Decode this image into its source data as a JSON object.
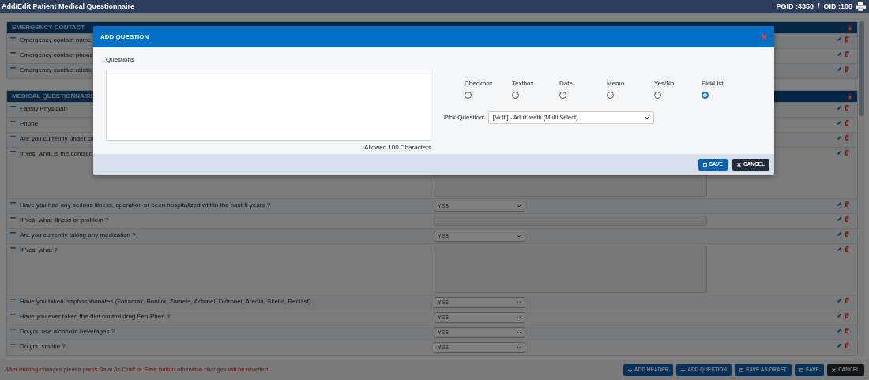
{
  "header": {
    "title": "Add/Edit Patient Medical Questionnaire",
    "ids": "PGID :4350  /  OID :100"
  },
  "sections": [
    {
      "title": "EMERGENCY CONTACT",
      "rows": [
        {
          "label": "Emergency contact name"
        },
        {
          "label": "Emergency contact phone"
        },
        {
          "label": "Emergency contact relatio"
        }
      ]
    },
    {
      "title": "MEDICAL QUESTIONNAIRE",
      "rows": [
        {
          "label": "Family Physician"
        },
        {
          "label": "Phone"
        },
        {
          "label": "Are you currently under ca"
        },
        {
          "label": "If Yes, what is the conditio",
          "kind": "memo"
        },
        {
          "label": "Have you had any serious illness, operation or been hospitalized within the past 5 years ?",
          "kind": "select",
          "value": "YES"
        },
        {
          "label": "If Yes, what illness or problem ?",
          "kind": "text"
        },
        {
          "label": "Are you currently taking any medication ?",
          "kind": "select",
          "value": "YES"
        },
        {
          "label": "If Yes, what ?",
          "kind": "memo"
        },
        {
          "label": "Have you taken bisphosphonates (Fosamax, Boniva, Zometa, Actonel, Didronel, Aredia, Skelid, Reclast)",
          "kind": "select",
          "value": "YES"
        },
        {
          "label": "Have you ever taken the diet control drug Fen-Phen ?",
          "kind": "select",
          "value": "YES"
        },
        {
          "label": "Do you use alcoholic beverages ?",
          "kind": "select",
          "value": "YES"
        },
        {
          "label": "Do you smoke ?",
          "kind": "select",
          "value": "YES"
        }
      ]
    }
  ],
  "footer": {
    "note": "After making changes please press Save As Draft or Save button otherwise changes will be reverted.",
    "buttons": [
      {
        "label": "ADD HEADER",
        "kind": "add"
      },
      {
        "label": "ADD QUESTION",
        "kind": "add"
      },
      {
        "label": "SAVE AS DRAFT",
        "kind": "save"
      },
      {
        "label": "SAVE",
        "kind": "save"
      },
      {
        "label": "CANCEL",
        "kind": "cancel"
      }
    ]
  },
  "modal": {
    "title": "ADD QUESTION",
    "questions_label": "Questions",
    "allowed": "Allowed 100 Characters",
    "types": [
      {
        "label": "Checkbox",
        "selected": false
      },
      {
        "label": "Textbox",
        "selected": false
      },
      {
        "label": "Date",
        "selected": false
      },
      {
        "label": "Memo",
        "selected": false
      },
      {
        "label": "Yes/No",
        "selected": false
      },
      {
        "label": "PickList",
        "selected": true
      }
    ],
    "pick_label": "Pick Question:",
    "pick_value": "[Multi] - Adult teeth (Multi Select)",
    "buttons": [
      {
        "label": "SAVE",
        "kind": "save"
      },
      {
        "label": "CANCEL",
        "kind": "cancel"
      }
    ]
  }
}
